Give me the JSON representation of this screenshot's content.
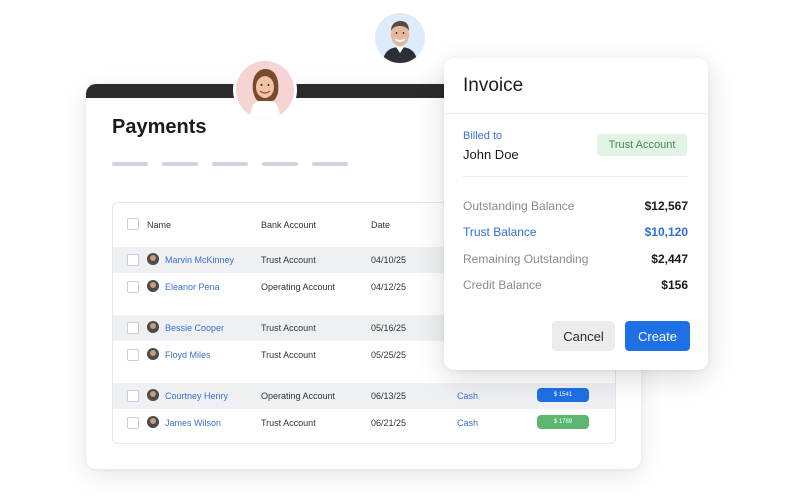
{
  "payments": {
    "title": "Payments",
    "columns": {
      "name": "Name",
      "bank_account": "Bank Account",
      "date": "Date"
    },
    "rows": [
      {
        "name": "Marvin McKinney",
        "bank_account": "Trust Account",
        "date": "04/10/25",
        "shaded": true
      },
      {
        "name": "Eleanor Pena",
        "bank_account": "Operating Account",
        "date": "04/12/25",
        "shaded": false
      },
      {
        "name": "Bessie Cooper",
        "bank_account": "Trust Account",
        "date": "05/16/25",
        "shaded": true
      },
      {
        "name": "Floyd Miles",
        "bank_account": "Trust Account",
        "date": "05/25/25",
        "shaded": false
      },
      {
        "name": "Courtney Henry",
        "bank_account": "Operating Account",
        "date": "06/13/25",
        "method": "Cash",
        "amount": "$ 1541",
        "amount_color": "#1f6fe5",
        "shaded": true
      },
      {
        "name": "James Wilson",
        "bank_account": "Trust Account",
        "date": "06/21/25",
        "method": "Cash",
        "amount": "$ 1789",
        "amount_color": "#5cb870",
        "shaded": false
      }
    ]
  },
  "invoice": {
    "title": "Invoice",
    "billed_to_label": "Billed to",
    "billed_to_name": "John Doe",
    "account_badge": "Trust Account",
    "balances": [
      {
        "label": "Outstanding Balance",
        "value": "$12,567"
      },
      {
        "label": "Trust Balance",
        "value": "$10,120"
      },
      {
        "label": "Remaining Outstanding",
        "value": "$2,447"
      },
      {
        "label": "Credit Balance",
        "value": "$156"
      }
    ],
    "cancel_label": "Cancel",
    "create_label": "Create"
  },
  "colors": {
    "accent": "#1f6fe5",
    "trust_badge_bg": "#e3f4e6",
    "trust_badge_text": "#3a8f52",
    "header_bar": "#2b2b2b"
  }
}
